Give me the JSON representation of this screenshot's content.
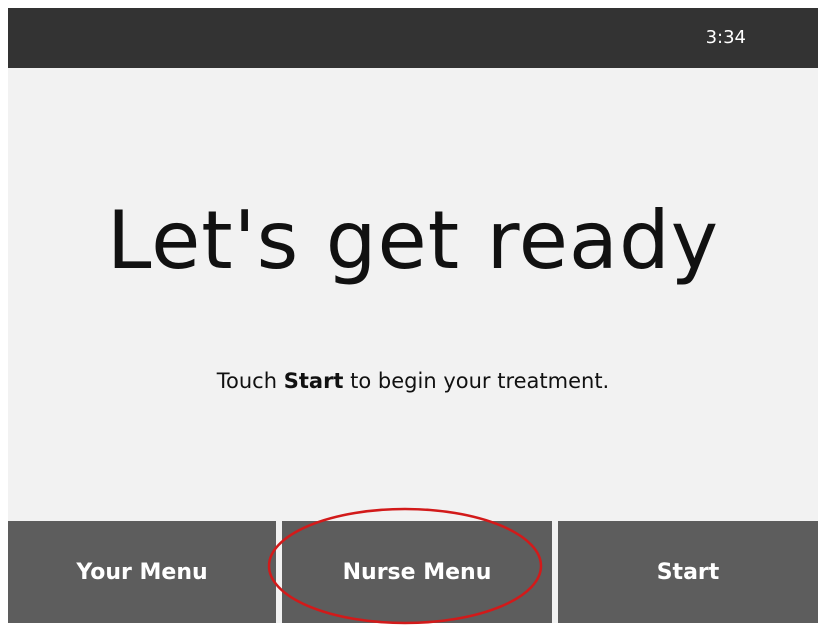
{
  "status_bar": {
    "time": "3:34"
  },
  "main": {
    "headline": "Let's get ready",
    "instruction_prefix": "Touch",
    "instruction_bold": "Start",
    "instruction_suffix": "to begin your treatment."
  },
  "bottom_menu": {
    "your_menu_label": "Your Menu",
    "nurse_menu_label": "Nurse Menu",
    "start_label": "Start"
  },
  "colors": {
    "status_bar_bg": "#333333",
    "screen_bg": "#f2f2f2",
    "button_bg": "#5d5d5d",
    "annotation_red": "#d21a1a"
  }
}
